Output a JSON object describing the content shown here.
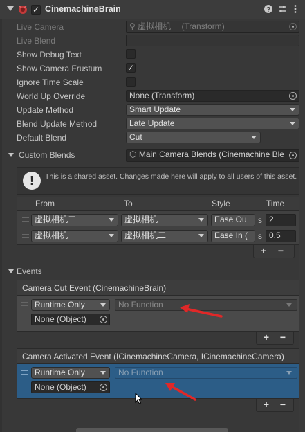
{
  "header": {
    "title": "CinemachineBrain",
    "enabled": true,
    "icons": [
      "help-icon",
      "presets-icon",
      "kebab-menu-icon"
    ]
  },
  "properties": {
    "live_camera": {
      "label": "Live Camera",
      "value": "虚拟相机一 (Transform)"
    },
    "live_blend": {
      "label": "Live Blend",
      "value": ""
    },
    "show_debug_text": {
      "label": "Show Debug Text",
      "checked": false
    },
    "show_camera_frustum": {
      "label": "Show Camera Frustum",
      "checked": true
    },
    "ignore_time_scale": {
      "label": "Ignore Time Scale",
      "checked": false
    },
    "world_up_override": {
      "label": "World Up Override",
      "value": "None (Transform)"
    },
    "update_method": {
      "label": "Update Method",
      "value": "Smart Update"
    },
    "blend_update_method": {
      "label": "Blend Update Method",
      "value": "Late Update"
    },
    "default_blend": {
      "label": "Default Blend",
      "value": "Cut"
    },
    "custom_blends": {
      "label": "Custom Blends",
      "value": "Main Camera Blends (Cinemachine Ble"
    }
  },
  "info": {
    "text": "This is a shared asset.  Changes made here will apply to all users of this asset."
  },
  "blends_table": {
    "headers": [
      "From",
      "To",
      "Style",
      "Time"
    ],
    "unit": "s",
    "rows": [
      {
        "from": "虚拟相机二",
        "to": "虚拟相机一",
        "style": "Ease Ou",
        "time": "2"
      },
      {
        "from": "虚拟相机一",
        "to": "虚拟相机二",
        "style": "Ease In (",
        "time": "0.5"
      }
    ]
  },
  "events": {
    "label": "Events",
    "cut_event": {
      "title": "Camera Cut Event (CinemachineBrain)",
      "runtime": "Runtime Only",
      "function": "No Function",
      "object": "None (Object)"
    },
    "activated_event": {
      "title": "Camera Activated Event (ICinemachineCamera, ICinemachineCamera)",
      "runtime": "Runtime Only",
      "function": "No Function",
      "object": "None (Object)"
    }
  },
  "buttons": {
    "plus": "+",
    "minus": "−"
  },
  "colors": {
    "background": "#383838",
    "selection": "#2c5d87",
    "annotation_arrow": "#e02828"
  }
}
